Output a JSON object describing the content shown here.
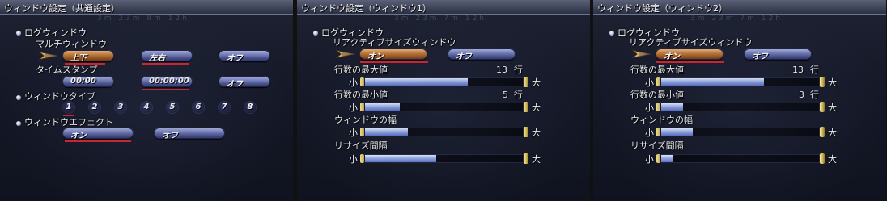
{
  "colors": {
    "selected_button": "#c77e38",
    "button": "#7e88c0",
    "underline": "#d8202a",
    "slider_fill": "#9aaee6"
  },
  "panel1": {
    "title": "ウィンドウ設定（共通設定）",
    "ghost": "3m 23m 8m 12h",
    "log_window": "ログウィンドウ",
    "multi_window": "マルチウィンドウ",
    "multi_options": [
      "上下",
      "左右",
      "オフ"
    ],
    "timestamp": "タイムスタンプ",
    "timestamp_options": [
      "00:00",
      "00:00:00",
      "オフ"
    ],
    "window_type": "ウィンドウタイプ",
    "window_type_numbers": [
      "1",
      "2",
      "3",
      "4",
      "5",
      "6",
      "7",
      "8"
    ],
    "window_effect": "ウィンドウエフェクト",
    "effect_options": [
      "オン",
      "オフ"
    ]
  },
  "panel2": {
    "title": "ウィンドウ設定（ウィンドウ1）",
    "ghost": "3m 23m 7m 12h",
    "log_window": "ログウィンドウ",
    "reactive": "リアクティブサイズウィンドウ",
    "reactive_options": [
      "オン",
      "オフ"
    ],
    "max_lines_label": "行数の最大値",
    "max_lines_value": "13",
    "min_lines_label": "行数の最小値",
    "min_lines_value": "5",
    "unit": "行",
    "width_label": "ウィンドウの幅",
    "resize_label": "リサイズ間隔",
    "small": "小",
    "large": "大",
    "sliders": [
      0.65,
      0.22,
      0.27,
      0.45
    ]
  },
  "panel3": {
    "title": "ウィンドウ設定（ウィンドウ2）",
    "ghost": "3m 23m 7m 12h",
    "log_window": "ログウィンドウ",
    "reactive": "リアクティブサイズウィンドウ",
    "reactive_options": [
      "オン",
      "オフ"
    ],
    "max_lines_label": "行数の最大値",
    "max_lines_value": "13",
    "min_lines_label": "行数の最小値",
    "min_lines_value": "3",
    "unit": "行",
    "width_label": "ウィンドウの幅",
    "resize_label": "リサイズ間隔",
    "small": "小",
    "large": "大",
    "sliders": [
      0.65,
      0.14,
      0.2,
      0.07
    ]
  }
}
